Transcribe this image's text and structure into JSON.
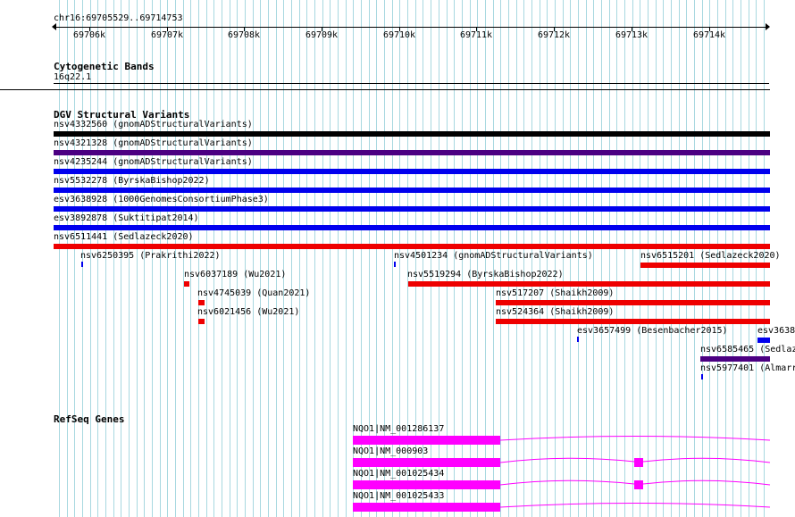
{
  "ruler": {
    "locus": "chr16:69705529..69714753",
    "ticks": [
      "69706k",
      "69707k",
      "69708k",
      "69709k",
      "69710k",
      "69711k",
      "69712k",
      "69713k",
      "69714k"
    ]
  },
  "cytoband": {
    "title": "Cytogenetic Bands",
    "band": "16q22.1"
  },
  "dgv": {
    "title": "DGV Structural Variants",
    "full_span": [
      {
        "label": "nsv4332560 (gnomADStructuralVariants)",
        "color": "#000000"
      },
      {
        "label": "nsv4321328 (gnomADStructuralVariants)",
        "color": "#4b0082"
      },
      {
        "label": "nsv4235244 (gnomADStructuralVariants)",
        "color": "#0000ee"
      },
      {
        "label": "nsv5532278 (ByrskaBishop2022)",
        "color": "#0000ee"
      },
      {
        "label": "esv3638928 (1000GenomesConsortiumPhase3)",
        "color": "#0000ee"
      },
      {
        "label": "esv3892878 (Suktitipat2014)",
        "color": "#0000ee"
      },
      {
        "label": "nsv6511441 (Sedlazeck2020)",
        "color": "#ee0000"
      }
    ],
    "partial": [
      {
        "label": "nsv6250395 (Prakrithi2022)",
        "color": "#0000ee"
      },
      {
        "label": "nsv4501234 (gnomADStructuralVariants)",
        "color": "#0000ee"
      },
      {
        "label": "nsv6515201 (Sedlazeck2020)",
        "color": "#ee0000"
      },
      {
        "label": "nsv6037189 (Wu2021)",
        "color": "#ee0000"
      },
      {
        "label": "nsv5519294 (ByrskaBishop2022)",
        "color": "#ee0000"
      },
      {
        "label": "nsv4745039 (Quan2021)",
        "color": "#ee0000"
      },
      {
        "label": "nsv517207 (Shaikh2009)",
        "color": "#ee0000"
      },
      {
        "label": "nsv6021456 (Wu2021)",
        "color": "#ee0000"
      },
      {
        "label": "nsv524364 (Shaikh2009)",
        "color": "#ee0000"
      },
      {
        "label": "esv3657499 (Besenbacher2015)",
        "color": "#0000ee"
      },
      {
        "label": "esv3638",
        "color": "#0000ee"
      },
      {
        "label": "nsv6585465 (Sedlaz",
        "color": "#4b0082"
      },
      {
        "label": "nsv5977401 (Almarr",
        "color": "#0000ee"
      }
    ]
  },
  "refseq": {
    "title": "RefSeq Genes",
    "gene_color": "#ff00ff",
    "transcripts": [
      "NQO1|NM_001286137",
      "NQO1|NM_000903",
      "NQO1|NM_001025434",
      "NQO1|NM_001025433"
    ]
  },
  "colors": {
    "grid_line": "#a8d8e0",
    "loss": "#ee0000",
    "gain": "#0000ee",
    "complex": "#4b0082"
  }
}
